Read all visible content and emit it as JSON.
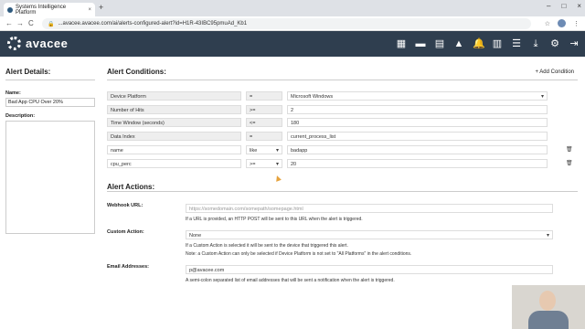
{
  "browser": {
    "tab_title": "Systems Intelligence Platform",
    "tab_close": "×",
    "new_tab": "+",
    "url": "...avacee.avacee.com/ai/alerts-configured-alert?id=H1R-43IBC95pmuAd_Kb1",
    "back": "←",
    "forward": "→",
    "reload": "C",
    "window_min": "–",
    "window_max": "□",
    "window_close": "×",
    "star": "☆",
    "menu": "⋮"
  },
  "app": {
    "brand": "avacee",
    "header_icons": [
      "dashboard-icon",
      "monitor-icon",
      "report-icon",
      "alert-icon",
      "bell-icon",
      "chart-icon",
      "list-icon",
      "download-icon",
      "gear-icon",
      "logout-icon"
    ],
    "header_glyphs": [
      "▦",
      "▬",
      "▤",
      "▲",
      "🔔",
      "▥",
      "☰",
      "⤓",
      "⚙",
      "⇥"
    ]
  },
  "alert_details": {
    "heading": "Alert Details:",
    "name_label": "Name:",
    "name_value": "Bad App CPU Over 20%",
    "description_label": "Description:"
  },
  "alert_conditions": {
    "heading": "Alert Conditions:",
    "add_condition": "+ Add Condition",
    "rows": [
      {
        "field": "Device Platform",
        "op": "=",
        "value": "Microsoft Windows",
        "value_select": true,
        "deletable": false
      },
      {
        "field": "Number of Hits",
        "op": ">=",
        "value": "2",
        "value_select": false,
        "deletable": false
      },
      {
        "field": "Time Window (seconds)",
        "op": "<=",
        "value": "180",
        "value_select": false,
        "deletable": false
      },
      {
        "field": "Data Index",
        "op": "=",
        "value": "current_process_list",
        "value_select": false,
        "deletable": false
      },
      {
        "field": "name",
        "op": "like",
        "value": "badapp",
        "value_select": false,
        "deletable": true
      },
      {
        "field": "cpu_perc",
        "op": ">=",
        "value": "20",
        "value_select": false,
        "deletable": true
      }
    ]
  },
  "alert_actions": {
    "heading": "Alert Actions:",
    "webhook_label": "Webhook URL:",
    "webhook_placeholder": "https://somedomain.com/somepath/somepage.html",
    "webhook_help": "If a URL is provided, an HTTP POST will be sent to this URL when the alert is triggered.",
    "custom_action_label": "Custom Action:",
    "custom_action_value": "None",
    "custom_action_help1": "If a Custom Action is selected it will be sent to the device that triggered this alert.",
    "custom_action_help2": "Note: a Custom Action can only be selected if Device Platform is not set to \"All Platforms\" in the alert conditions.",
    "email_label": "Email Addresses:",
    "email_value": "p@avacee.com",
    "email_help": "A semi-colon separated list of email addresses that will be sent a notification when the alert is triggered."
  }
}
